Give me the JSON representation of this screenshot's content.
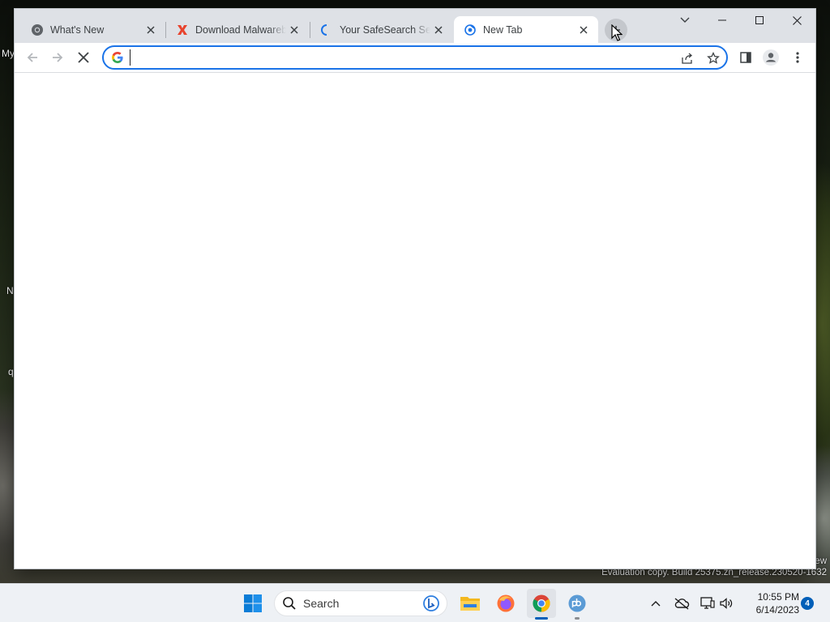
{
  "desktop": {
    "icon_labels": [
      "My",
      "N",
      "q"
    ],
    "watermark_line1": "ew",
    "watermark_line2": "Evaluation copy. Build 25375.zn_release.230520-1632"
  },
  "browser": {
    "tabs": [
      {
        "title": "What's New",
        "favicon": "chrome-icon",
        "active": false
      },
      {
        "title": "Download Malwarebytes",
        "favicon": "malwarebytes-icon",
        "active": false
      },
      {
        "title": "Your SafeSearch Settings",
        "favicon": "loading-spinner-icon",
        "active": false
      },
      {
        "title": "New Tab",
        "favicon": "chrome-newtab-icon",
        "active": true
      }
    ],
    "omnibox": {
      "value": "",
      "placeholder": ""
    },
    "colors": {
      "accent": "#1a73e8",
      "tabstrip": "#dee1e6"
    }
  },
  "taskbar": {
    "search_label": "Search",
    "apps": [
      "windows-start-icon",
      "search-icon",
      "file-explorer-icon",
      "firefox-icon",
      "chrome-icon",
      "qbittorrent-icon"
    ],
    "clock_time": "10:55 PM",
    "clock_date": "6/14/2023",
    "notification_count": "4"
  }
}
